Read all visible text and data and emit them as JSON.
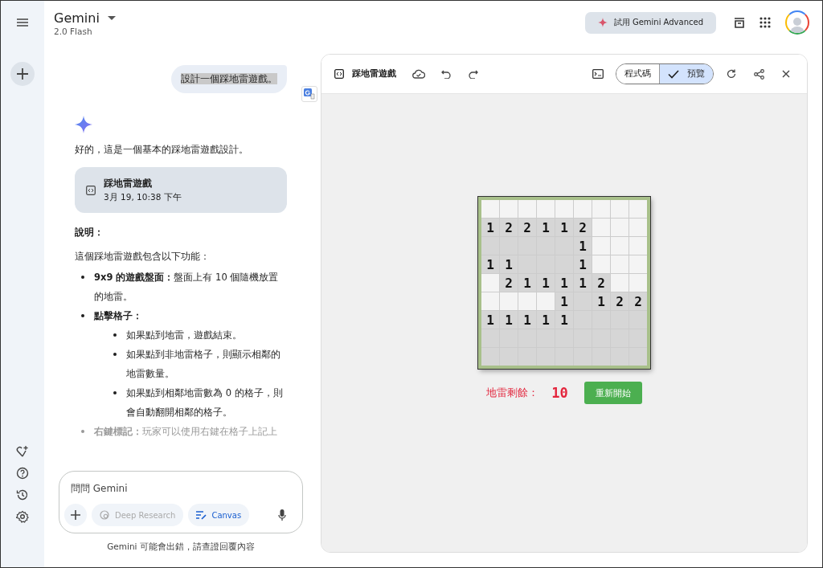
{
  "header": {
    "title": "Gemini",
    "model": "2.0 Flash",
    "upgrade_button": "試用 Gemini Advanced"
  },
  "chat": {
    "user_message": "設計一個踩地雷遊戲。",
    "reply_intro": "好的，這是一個基本的踩地雷遊戲設計。",
    "artifact_card": {
      "title": "踩地雷遊戲",
      "timestamp": "3月 19, 10:38 下午"
    },
    "heading": "說明：",
    "paragraph": "這個踩地雷遊戲包含以下功能：",
    "bullets": [
      {
        "label": "9x9 的遊戲盤面：",
        "text": "盤面上有 10 個隨機放置的地雷。"
      },
      {
        "label": "點擊格子：",
        "children": [
          {
            "text": "如果點到地雷，遊戲結束。"
          },
          {
            "text": "如果點到非地雷格子，則顯示相鄰的地雷數量。"
          },
          {
            "text": "如果點到相鄰地雷數為 0 的格子，則會自動翻開相鄰的格子。"
          }
        ]
      },
      {
        "label": "右鍵標記：",
        "text": "玩家可以使用右鍵在格子上記上"
      }
    ]
  },
  "composer": {
    "placeholder": "問問 Gemini",
    "tools": [
      {
        "label": "Deep Research",
        "active": false
      },
      {
        "label": "Canvas",
        "active": true
      }
    ]
  },
  "disclaimer": "Gemini 可能會出錯，請查證回覆內容",
  "canvas": {
    "title": "踩地雷遊戲",
    "view_tabs": [
      {
        "label": "程式碼",
        "selected": false
      },
      {
        "label": "預覽",
        "selected": true
      }
    ],
    "game": {
      "board": [
        [
          {
            "revealed": false
          },
          {
            "revealed": false
          },
          {
            "revealed": false
          },
          {
            "revealed": false
          },
          {
            "revealed": false
          },
          {
            "revealed": false
          },
          {
            "revealed": false
          },
          {
            "revealed": false
          },
          {
            "revealed": false
          }
        ],
        [
          {
            "revealed": true,
            "number": "1"
          },
          {
            "revealed": true,
            "number": "2"
          },
          {
            "revealed": true,
            "number": "2"
          },
          {
            "revealed": true,
            "number": "1"
          },
          {
            "revealed": true,
            "number": "1"
          },
          {
            "revealed": true,
            "number": "2"
          },
          {
            "revealed": false
          },
          {
            "revealed": false
          },
          {
            "revealed": false
          }
        ],
        [
          {
            "revealed": true
          },
          {
            "revealed": true
          },
          {
            "revealed": true
          },
          {
            "revealed": true
          },
          {
            "revealed": true
          },
          {
            "revealed": true,
            "number": "1"
          },
          {
            "revealed": false
          },
          {
            "revealed": false
          },
          {
            "revealed": false
          }
        ],
        [
          {
            "revealed": true,
            "number": "1"
          },
          {
            "revealed": true,
            "number": "1"
          },
          {
            "revealed": true
          },
          {
            "revealed": true
          },
          {
            "revealed": true
          },
          {
            "revealed": true,
            "number": "1"
          },
          {
            "revealed": false
          },
          {
            "revealed": false
          },
          {
            "revealed": false
          }
        ],
        [
          {
            "revealed": false
          },
          {
            "revealed": true,
            "number": "2"
          },
          {
            "revealed": true,
            "number": "1"
          },
          {
            "revealed": true,
            "number": "1"
          },
          {
            "revealed": true,
            "number": "1"
          },
          {
            "revealed": true,
            "number": "1"
          },
          {
            "revealed": true,
            "number": "2"
          },
          {
            "revealed": false
          },
          {
            "revealed": false
          }
        ],
        [
          {
            "revealed": false
          },
          {
            "revealed": false
          },
          {
            "revealed": false
          },
          {
            "revealed": false
          },
          {
            "revealed": true,
            "number": "1"
          },
          {
            "revealed": true
          },
          {
            "revealed": true,
            "number": "1"
          },
          {
            "revealed": true,
            "number": "2"
          },
          {
            "revealed": true,
            "number": "2"
          }
        ],
        [
          {
            "revealed": true,
            "number": "1"
          },
          {
            "revealed": true,
            "number": "1"
          },
          {
            "revealed": true,
            "number": "1"
          },
          {
            "revealed": true,
            "number": "1"
          },
          {
            "revealed": true,
            "number": "1"
          },
          {
            "revealed": true
          },
          {
            "revealed": true
          },
          {
            "revealed": true
          },
          {
            "revealed": true
          }
        ],
        [
          {
            "revealed": true
          },
          {
            "revealed": true
          },
          {
            "revealed": true
          },
          {
            "revealed": true
          },
          {
            "revealed": true
          },
          {
            "revealed": true
          },
          {
            "revealed": true
          },
          {
            "revealed": true
          },
          {
            "revealed": true
          }
        ],
        [
          {
            "revealed": true
          },
          {
            "revealed": true
          },
          {
            "revealed": true
          },
          {
            "revealed": true
          },
          {
            "revealed": true
          },
          {
            "revealed": true
          },
          {
            "revealed": true
          },
          {
            "revealed": true
          },
          {
            "revealed": true
          }
        ]
      ],
      "mines_label": "地雷剩餘：",
      "mines_count": "10",
      "restart_button": "重新開始"
    }
  }
}
